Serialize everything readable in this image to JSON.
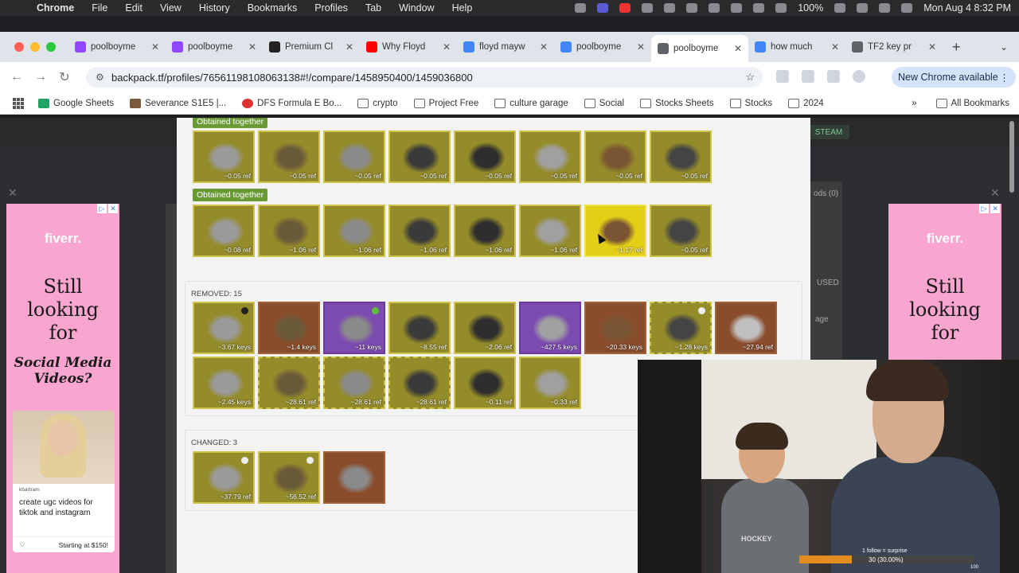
{
  "menubar": {
    "app": "Chrome",
    "items": [
      "File",
      "Edit",
      "View",
      "History",
      "Bookmarks",
      "Profiles",
      "Tab",
      "Window",
      "Help"
    ],
    "battery": "100%",
    "clock": "Mon Aug 4  8:32 PM"
  },
  "tabs": [
    {
      "title": "poolboyme",
      "color": "#9146ff"
    },
    {
      "title": "poolboyme",
      "color": "#9146ff"
    },
    {
      "title": "Premium Cl",
      "color": "#222222"
    },
    {
      "title": "Why Floyd",
      "color": "#ff0000"
    },
    {
      "title": "floyd mayw",
      "color": "#4285f4"
    },
    {
      "title": "poolboyme",
      "color": "#4285f4"
    },
    {
      "title": "poolboyme",
      "color": "#5f6368"
    },
    {
      "title": "how much",
      "color": "#4285f4"
    },
    {
      "title": "TF2 key pr",
      "color": "#5f6368"
    }
  ],
  "toolbar": {
    "url": "backpack.tf/profiles/76561198108063138#!/compare/1458950400/1459036800",
    "new_chrome": "New Chrome available"
  },
  "bookmarks": {
    "items": [
      "Google Sheets",
      "Severance S1E5 |...",
      "DFS Formula E Bo...",
      "crypto",
      "Project Free",
      "culture garage",
      "Social",
      "Stocks Sheets",
      "Stocks",
      "2024"
    ],
    "more": "»",
    "all": "All Bookmarks"
  },
  "page": {
    "steam_button": "STEAM",
    "bg_texts": [
      "ods (0)",
      "USED",
      "age"
    ],
    "group1_label": "Obtained together",
    "group1_prices": [
      "~0.05 ref",
      "~0.05 ref",
      "~0.05 ref",
      "~0.05 ref",
      "~0.05 ref",
      "~0.05 ref",
      "~0.05 ref",
      "~0.05 ref"
    ],
    "group2_label": "Obtained together",
    "group2_prices": [
      "~0.08 ref",
      "~1.06 ref",
      "~1.06 ref",
      "~1.06 ref",
      "~1.06 ref",
      "~1.06 ref",
      "~1.17 ref",
      "~0.05 ref"
    ],
    "removed_label": "REMOVED: 15",
    "removed_row1": [
      "~3.67 keys",
      "~1.4 keys",
      "~11 keys",
      "~8.55 ref",
      "~2.06 ref",
      "~427.5 keys",
      "~20.33 keys",
      "~1.28 keys",
      "~27.94 ref"
    ],
    "removed_row2": [
      "~2.45 keys",
      "~28.61 ref",
      "~28.61 ref",
      "~28.61 ref",
      "~0.11 ref",
      "~0.33 ref"
    ],
    "changed_label": "CHANGED: 3",
    "changed_prices": [
      "~37.79 ref",
      "~56.52 ref",
      ""
    ]
  },
  "ad": {
    "logo": "fiverr.",
    "headline": "Still looking for",
    "sub": "Social Media Videos?",
    "user": "kbartram",
    "card_text": "create ugc videos for tiktok and instagram",
    "price": "Starting at $150!",
    "color": "#f8a6cf"
  },
  "webcam": {
    "shirt": "HOCKEY",
    "follow": "1 follow = surprise",
    "goal": "30 (30.00%)",
    "goal_percent": 30,
    "goal_max": "100"
  }
}
